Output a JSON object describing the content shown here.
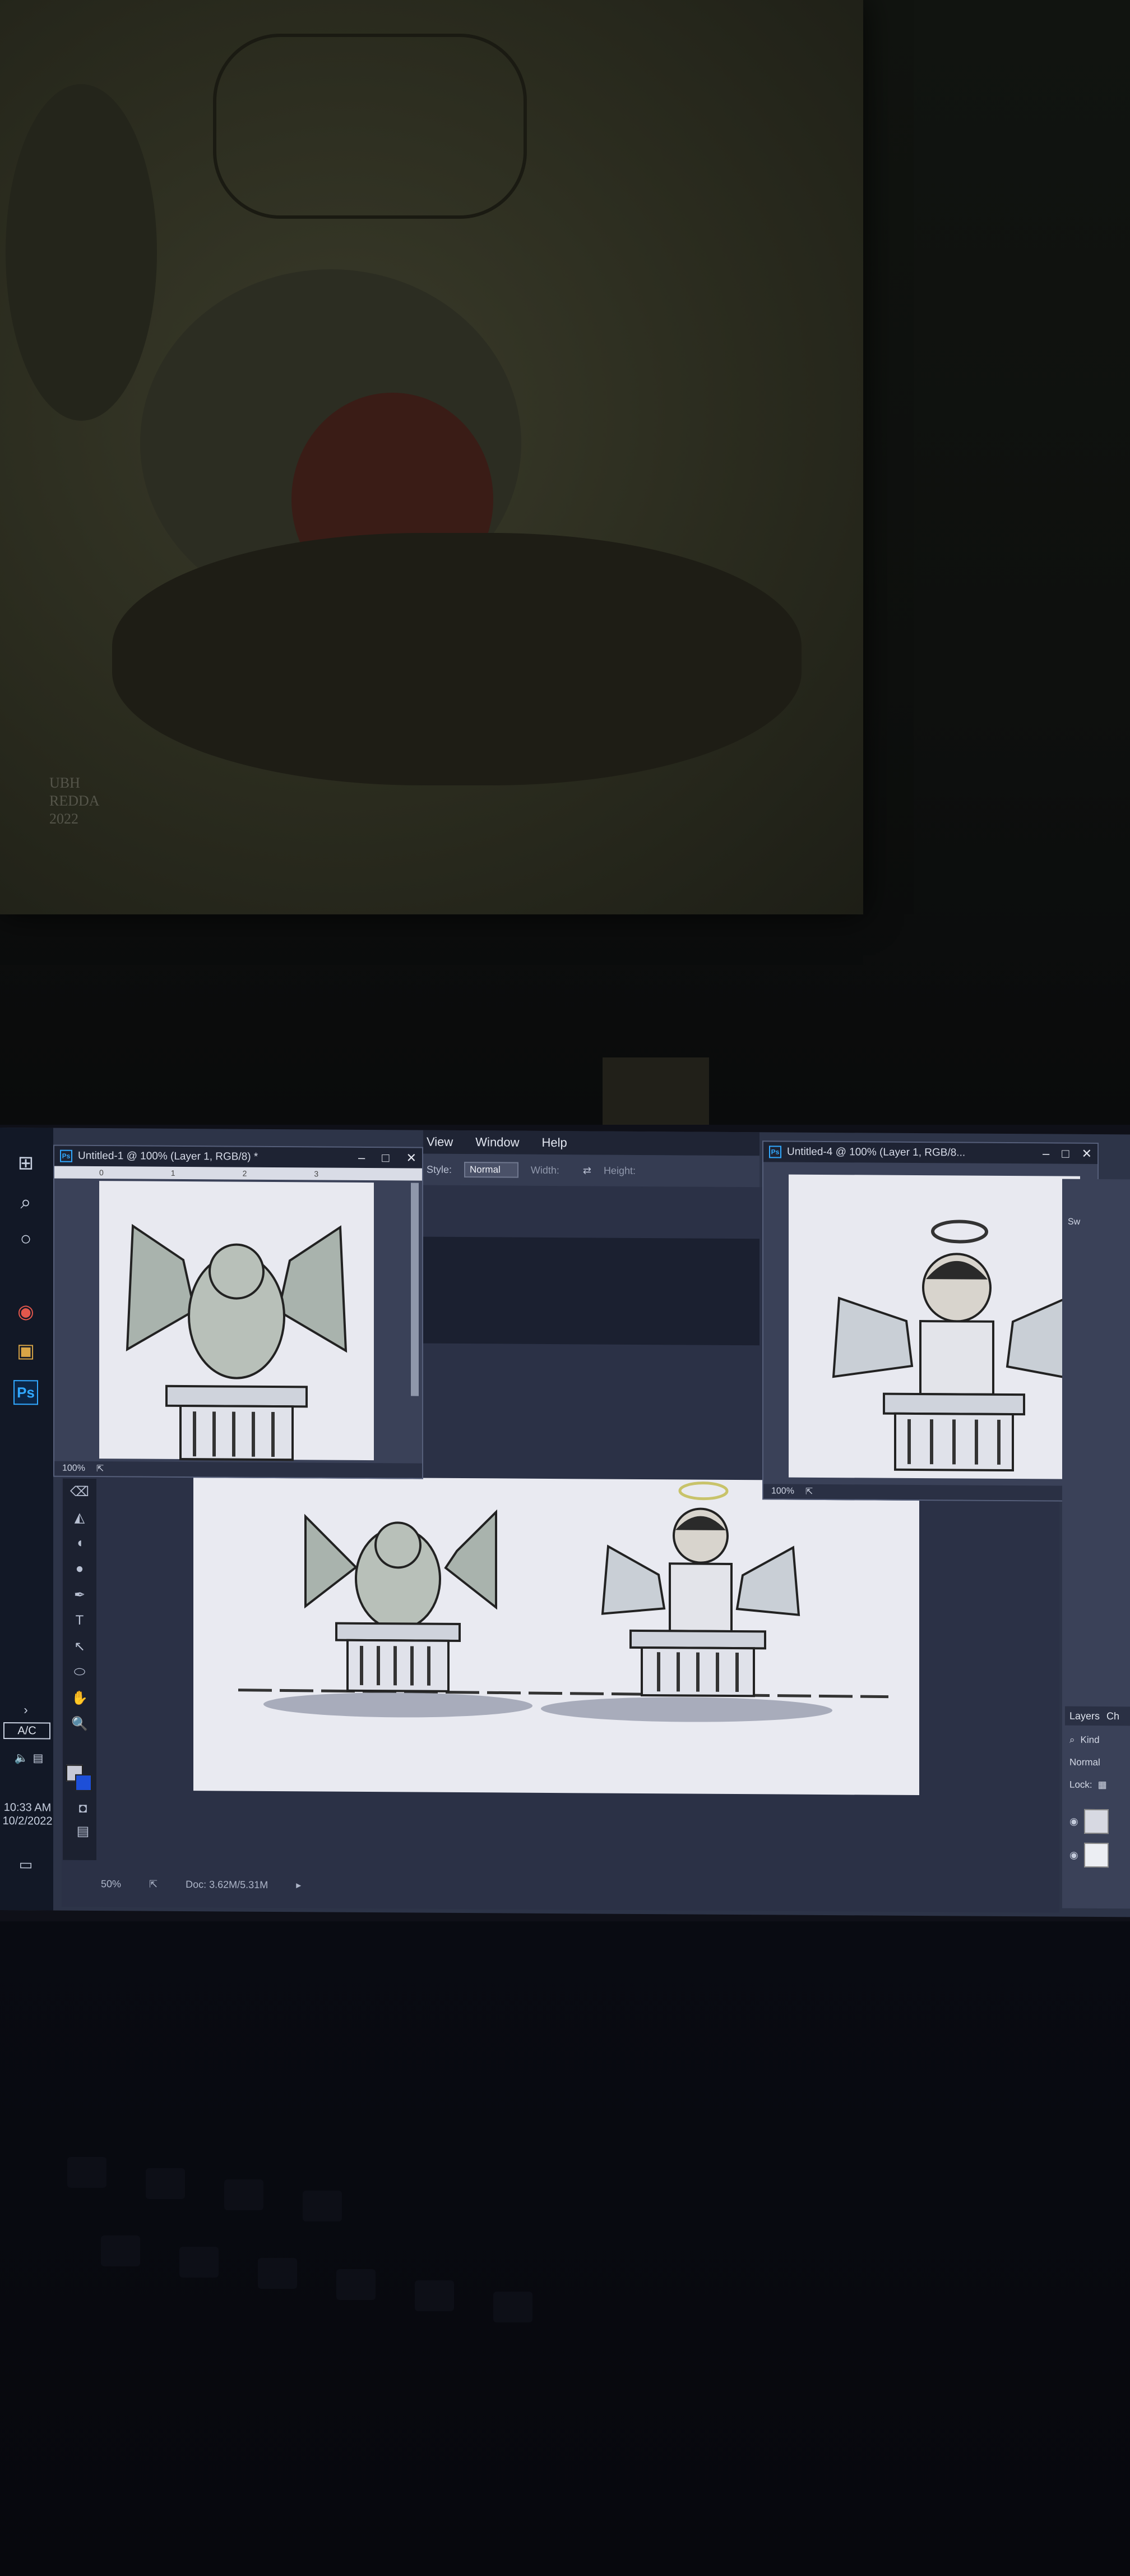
{
  "left_window": {
    "title": "Untitled-1 @ 100% (Layer 1, RGB/8) *",
    "ruler_marks": [
      "0",
      "1",
      "2",
      "3"
    ],
    "zoom": "100%"
  },
  "right_window": {
    "title": "Untitled-4 @ 100% (Layer 1, RGB/8...",
    "zoom": "100%"
  },
  "menu": {
    "items": [
      "View",
      "Window",
      "Help"
    ]
  },
  "options_bar": {
    "style_label": "Style:",
    "style_value": "Normal",
    "width_label": "Width:",
    "height_label": "Height:"
  },
  "main_document": {
    "zoom": "50%",
    "doc_size": "Doc: 3.62M/5.31M"
  },
  "taskbar": {
    "ps_label": "Ps",
    "input_indicator": "A/C",
    "time": "10:33 AM",
    "date": "10/2/2022"
  },
  "layers_panel": {
    "tab_layers": "Layers",
    "tab_other": "Ch",
    "kind_label": "Kind",
    "blend_mode": "Normal",
    "lock_label": "Lock:"
  },
  "swatches_label": "Sw",
  "poster": {
    "signature_lines": [
      "UBH",
      "REDDA",
      "2022"
    ]
  },
  "colors": {
    "ps_blue": "#31a8ff",
    "background_swatch": "#1d4fd8"
  }
}
